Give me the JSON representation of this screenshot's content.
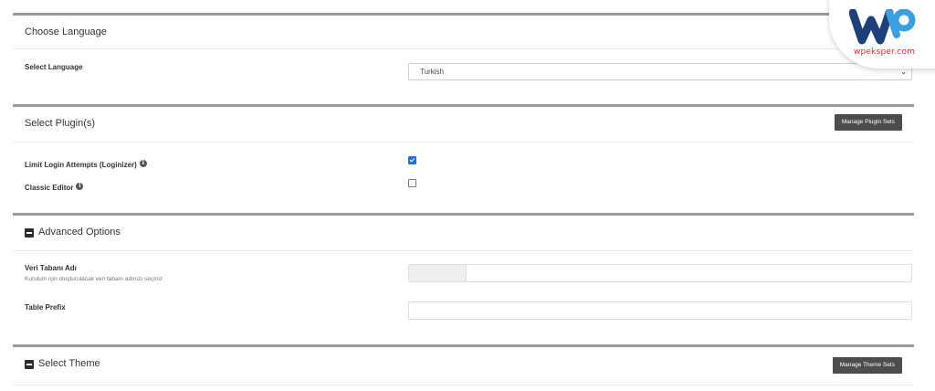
{
  "language": {
    "title": "Choose Language",
    "select_label": "Select Language",
    "selected_value": "Turkish"
  },
  "plugins": {
    "title": "Select Plugin(s)",
    "manage_button": "Manage Plugin Sets",
    "items": [
      {
        "label": "Limit Login Attempts (Loginizer)",
        "checked": true
      },
      {
        "label": "Classic Editor",
        "checked": false
      }
    ]
  },
  "advanced": {
    "title": "Advanced Options",
    "db_label": "Veri Tabanı Adı",
    "db_help": "Kurulum için oluşturulacak veri tabanı adınızı seçiniz",
    "prefix_label": "Table Prefix"
  },
  "theme": {
    "title": "Select Theme",
    "manage_button": "Manage Theme Sets"
  },
  "logo": {
    "text": "wpeksper.com",
    "colors": {
      "dark": "#1d3f7a",
      "light": "#3aa0e0",
      "text": "#e32b2b"
    }
  }
}
